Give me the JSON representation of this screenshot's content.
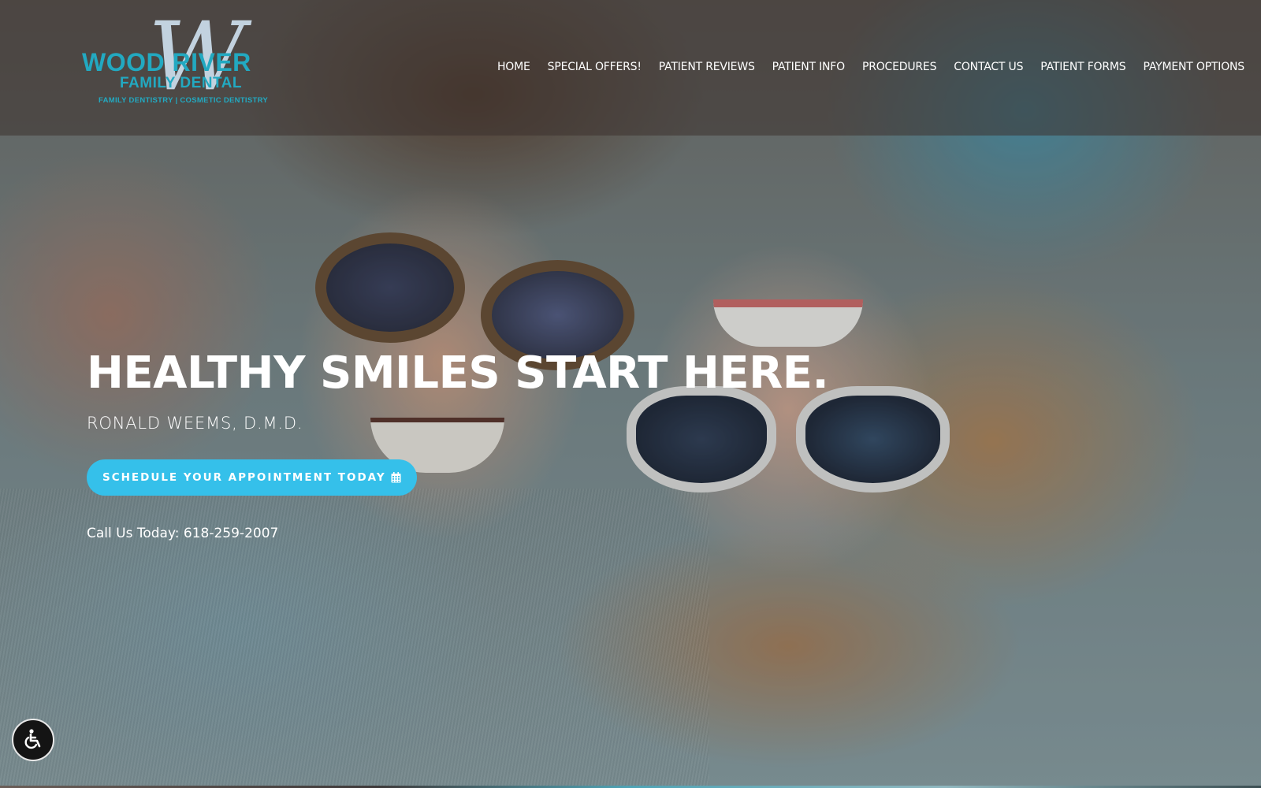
{
  "header": {
    "logo": {
      "monogram": "W",
      "line1": "WOOD RIVER",
      "line2": "FAMILY DENTAL",
      "line3": "FAMILY DENTISTRY | COSMETIC DENTISTRY"
    },
    "nav": [
      {
        "label": "HOME"
      },
      {
        "label": "SPECIAL OFFERS!"
      },
      {
        "label": "PATIENT REVIEWS"
      },
      {
        "label": "PATIENT INFO"
      },
      {
        "label": "PROCEDURES"
      },
      {
        "label": "CONTACT US"
      },
      {
        "label": "PATIENT FORMS"
      },
      {
        "label": "PAYMENT OPTIONS"
      }
    ]
  },
  "hero": {
    "title": "HEALTHY SMILES START HERE.",
    "subtitle": "RONALD WEEMS, D.M.D.",
    "cta_label": "SCHEDULE YOUR APPOINTMENT TODAY",
    "cta_icon": "calendar-icon",
    "phone_text": "Call Us Today: 618-259-2007",
    "background_image": "couple-smiling-upside-down-photo"
  },
  "accessibility": {
    "icon": "wheelchair-icon"
  },
  "colors": {
    "brand_teal": "#22a9c1",
    "cta_blue": "#35c0ea",
    "text_white": "#ffffff",
    "a11y_bg": "#141414"
  }
}
